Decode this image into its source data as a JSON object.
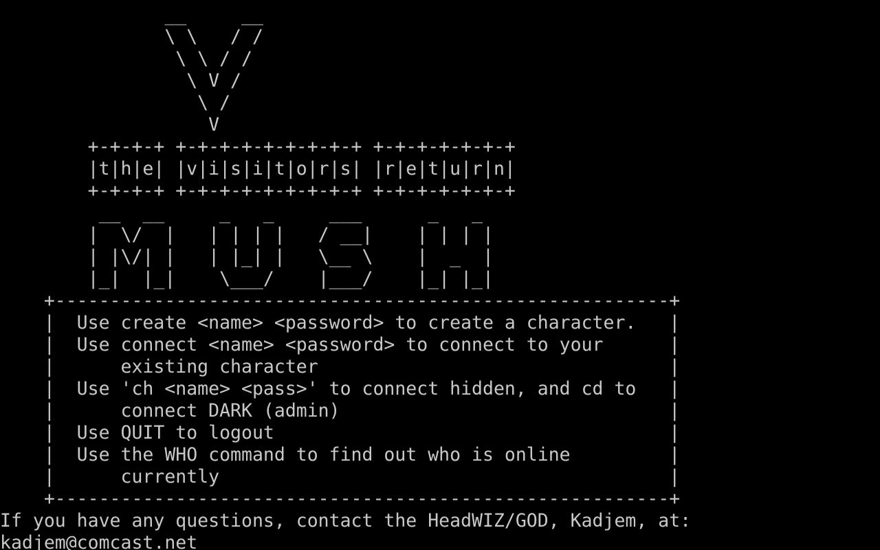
{
  "terminal": {
    "foreground": "#c8c8c8",
    "background": "#000000",
    "lines": [
      "               __     __",
      "               \\ \\   / /",
      "                \\ \\ / /",
      "                 \\ V /",
      "                  \\ /",
      "                   V",
      "        +-+-+-+ +-+-+-+-+-+-+-+-+ +-+-+-+-+-+-+",
      "        |t|h|e| |v|i|s|i|t|o|r|s| |r|e|t|u|r|n|",
      "        +-+-+-+ +-+-+-+-+-+-+-+-+ +-+-+-+-+-+-+",
      "         __  __     _   _     ___      _   _",
      "        |  \\/  |   | | | |   / __|    | | | |",
      "        | |\\/| |   | |_| |   \\__ \\    |  _  |",
      "        |_|  |_|    \\___/    |___/    |_| |_|",
      "    +--------------------------------------------------------+",
      "    |  Use create <name> <password> to create a character.   |",
      "    |  Use connect <name> <password> to connect to your      |",
      "    |      existing character                                |",
      "    |  Use 'ch <name> <pass>' to connect hidden, and cd to   |",
      "    |      connect DARK (admin)                              |",
      "    |  Use QUIT to logout                                    |",
      "    |  Use the WHO command to find out who is online         |",
      "    |      currently                                         |",
      "    +--------------------------------------------------------+",
      "If you have any questions, contact the HeadWIZ/GOD, Kadjem, at:",
      "kadjem@comcast.net"
    ]
  }
}
